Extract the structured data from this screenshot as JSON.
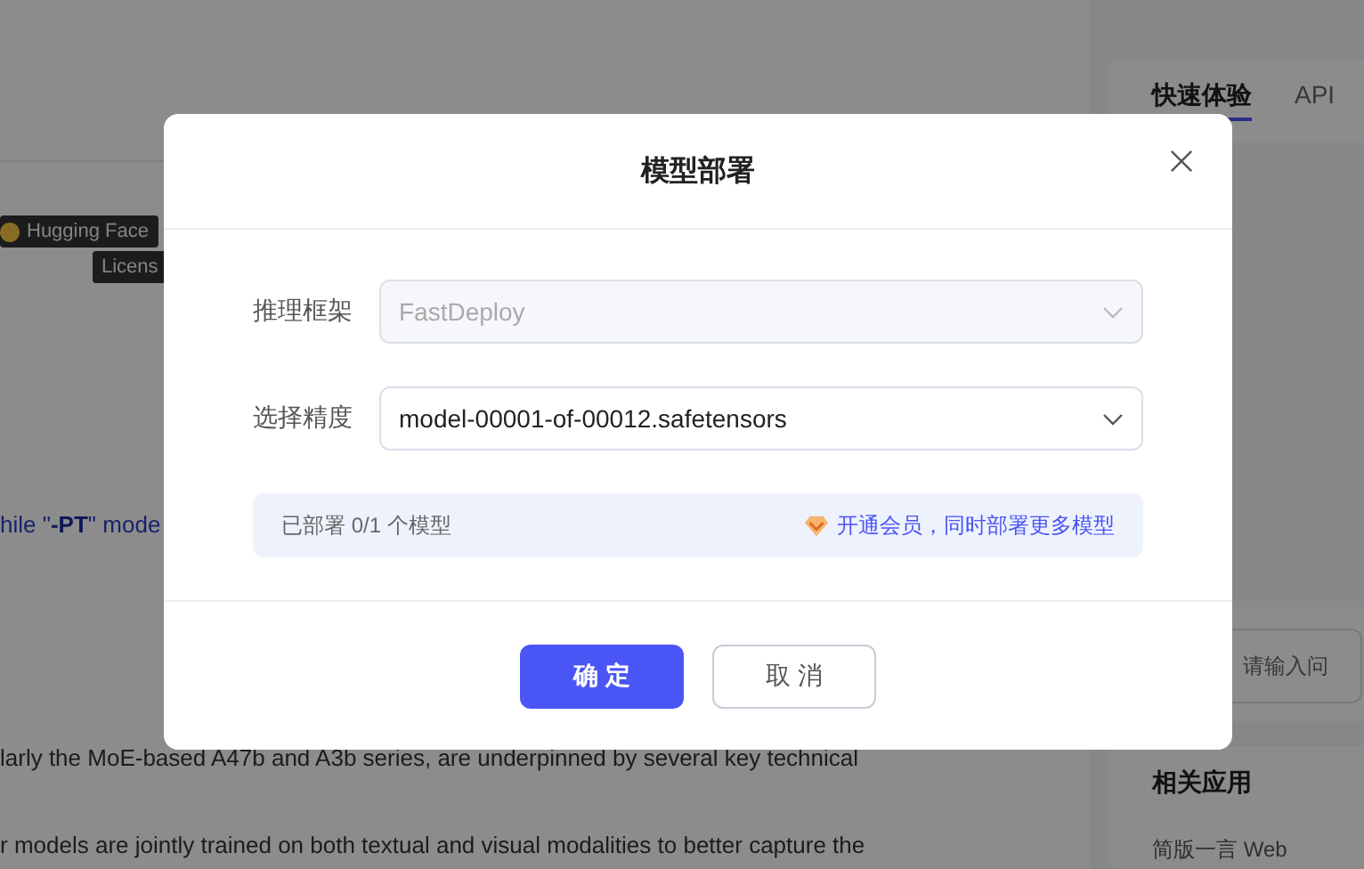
{
  "background": {
    "badges": [
      {
        "label": "Hugging Face",
        "kind": "hf"
      },
      {
        "label": "Licens",
        "kind": "plain"
      }
    ],
    "link_text": "hile \"**-PT**\" mode",
    "paragraphs": [
      "larly the MoE-based A47b and A3b series, are underpinned by several key technical",
      "r models are jointly trained on both textual and visual modalities to better capture the"
    ],
    "side_panel": {
      "tabs": [
        {
          "label": "快速体验",
          "selected": true
        },
        {
          "label": "API",
          "selected": false
        }
      ],
      "input": {
        "placeholder": "请输入问"
      },
      "section_title": "相关应用",
      "app_item": "简版一言 Web"
    }
  },
  "dialog": {
    "title": "模型部署",
    "fields": [
      {
        "label": "推理框架",
        "value": "FastDeploy",
        "disabled": true
      },
      {
        "label": "选择精度",
        "value": "model-00001-of-00012.safetensors",
        "disabled": false
      }
    ],
    "quota": "已部署 0/1 个模型",
    "upgrade_link": "开通会员，同时部署更多模型",
    "buttons": [
      {
        "label": "确 定",
        "kind": "primary"
      },
      {
        "label": "取 消",
        "kind": "secondary"
      }
    ]
  }
}
